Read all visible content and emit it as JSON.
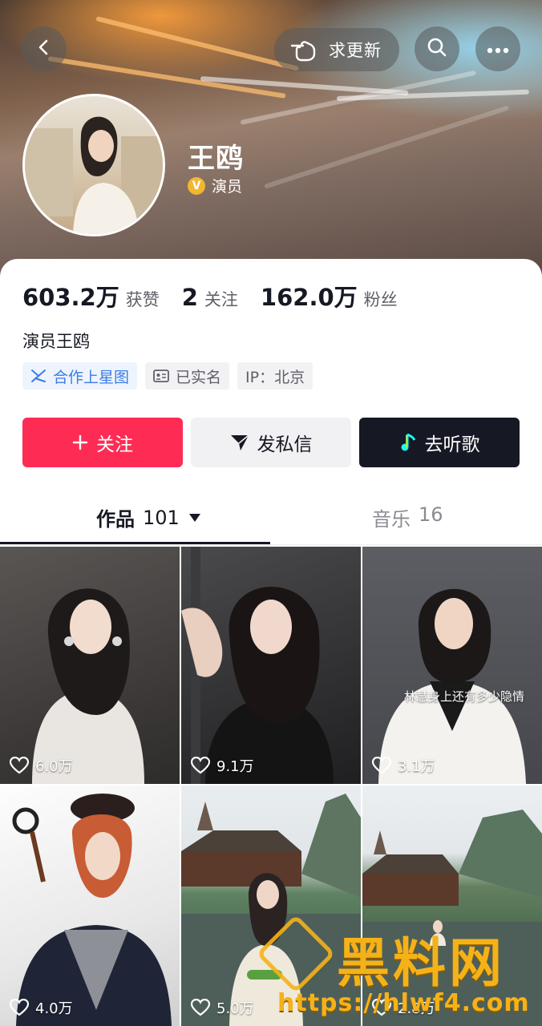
{
  "header": {
    "update_label": "求更新",
    "profile_name": "王鸥",
    "verification_label": "演员"
  },
  "stats": [
    {
      "value": "603.2万",
      "label": "获赞"
    },
    {
      "value": "2",
      "label": "关注"
    },
    {
      "value": "162.0万",
      "label": "粉丝"
    }
  ],
  "bio": "演员王鸥",
  "tags": {
    "cooperation": "合作上星图",
    "real_name": "已实名",
    "ip": "IP：北京"
  },
  "actions": {
    "follow": "关注",
    "message": "发私信",
    "music": "去听歌"
  },
  "tabs": {
    "works_label": "作品",
    "works_count": "101",
    "music_label": "音乐",
    "music_count": "16"
  },
  "videos": [
    {
      "likes": "6.0万"
    },
    {
      "likes": "9.1万"
    },
    {
      "likes": "3.1万",
      "caption": "林慧身上还有多少隐情"
    },
    {
      "likes": "4.0万"
    },
    {
      "likes": "5.0万"
    },
    {
      "likes": "2.8万"
    }
  ],
  "watermark": {
    "text": "黑料网",
    "url": "https://hlwf4.com"
  },
  "colors": {
    "follow_button": "#fe2c55",
    "music_button": "#161823",
    "link_blue": "#3b7ce8",
    "watermark": "#f5b218"
  },
  "icons": [
    "back-icon",
    "pointing-hand-icon",
    "search-icon",
    "more-icon",
    "verified-v-icon",
    "star-map-icon",
    "id-card-icon",
    "plus-icon",
    "send-icon",
    "music-note-icon",
    "heart-icon"
  ]
}
